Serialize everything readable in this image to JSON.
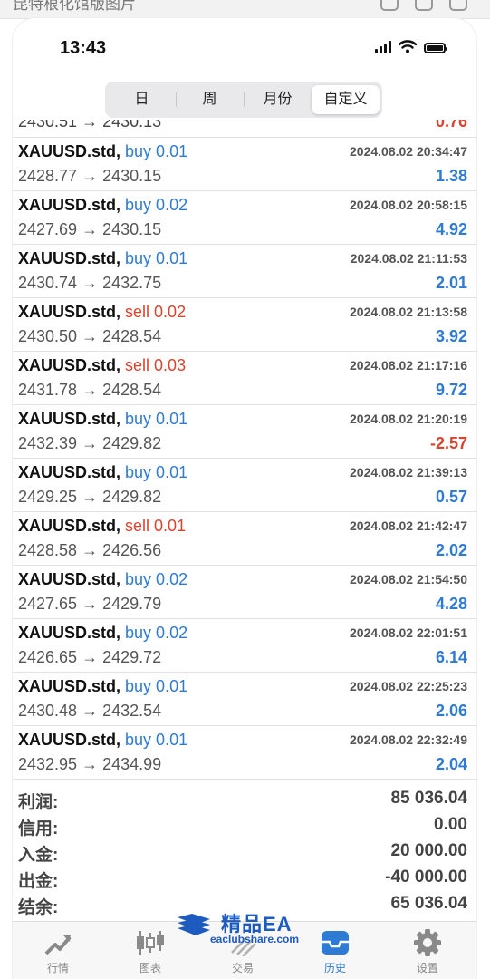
{
  "window": {
    "caption": "昆特根化馆版图片"
  },
  "status_bar": {
    "time": "13:43"
  },
  "period_tabs": [
    {
      "label": "日",
      "active": false
    },
    {
      "label": "周",
      "active": false
    },
    {
      "label": "月份",
      "active": false
    },
    {
      "label": "自定义",
      "active": true
    }
  ],
  "partial_row": {
    "prices": "2430.51 → 2430.13",
    "profit": "0.76"
  },
  "trades": [
    {
      "symbol": "XAUUSD.std,",
      "side": "buy 0.01",
      "type": "buy",
      "time": "2024.08.02 20:34:47",
      "prices": "2428.77 → 2430.15",
      "profit": "1.38"
    },
    {
      "symbol": "XAUUSD.std,",
      "side": "buy 0.02",
      "type": "buy",
      "time": "2024.08.02 20:58:15",
      "prices": "2427.69 → 2430.15",
      "profit": "4.92"
    },
    {
      "symbol": "XAUUSD.std,",
      "side": "buy 0.01",
      "type": "buy",
      "time": "2024.08.02 21:11:53",
      "prices": "2430.74 → 2432.75",
      "profit": "2.01"
    },
    {
      "symbol": "XAUUSD.std,",
      "side": "sell 0.02",
      "type": "sell",
      "time": "2024.08.02 21:13:58",
      "prices": "2430.50 → 2428.54",
      "profit": "3.92"
    },
    {
      "symbol": "XAUUSD.std,",
      "side": "sell 0.03",
      "type": "sell",
      "time": "2024.08.02 21:17:16",
      "prices": "2431.78 → 2428.54",
      "profit": "9.72"
    },
    {
      "symbol": "XAUUSD.std,",
      "side": "buy 0.01",
      "type": "buy",
      "time": "2024.08.02 21:20:19",
      "prices": "2432.39 → 2429.82",
      "profit": "-2.57"
    },
    {
      "symbol": "XAUUSD.std,",
      "side": "buy 0.01",
      "type": "buy",
      "time": "2024.08.02 21:39:13",
      "prices": "2429.25 → 2429.82",
      "profit": "0.57"
    },
    {
      "symbol": "XAUUSD.std,",
      "side": "sell 0.01",
      "type": "sell",
      "time": "2024.08.02 21:42:47",
      "prices": "2428.58 → 2426.56",
      "profit": "2.02"
    },
    {
      "symbol": "XAUUSD.std,",
      "side": "buy 0.02",
      "type": "buy",
      "time": "2024.08.02 21:54:50",
      "prices": "2427.65 → 2429.79",
      "profit": "4.28"
    },
    {
      "symbol": "XAUUSD.std,",
      "side": "buy 0.02",
      "type": "buy",
      "time": "2024.08.02 22:01:51",
      "prices": "2426.65 → 2429.72",
      "profit": "6.14"
    },
    {
      "symbol": "XAUUSD.std,",
      "side": "buy 0.01",
      "type": "buy",
      "time": "2024.08.02 22:25:23",
      "prices": "2430.48 → 2432.54",
      "profit": "2.06"
    },
    {
      "symbol": "XAUUSD.std,",
      "side": "buy 0.01",
      "type": "buy",
      "time": "2024.08.02 22:32:49",
      "prices": "2432.95 → 2434.99",
      "profit": "2.04"
    }
  ],
  "summary": [
    {
      "label": "利润:",
      "value": "85 036.04"
    },
    {
      "label": "信用:",
      "value": "0.00"
    },
    {
      "label": "入金:",
      "value": "20 000.00"
    },
    {
      "label": "出金:",
      "value": "-40 000.00"
    },
    {
      "label": "结余:",
      "value": "65 036.04"
    }
  ],
  "watermark": {
    "title": "精品EA",
    "subtitle": "eaclubshare.com"
  },
  "tab_bar": [
    {
      "label": "行情",
      "icon": "quotes-icon",
      "active": false
    },
    {
      "label": "图表",
      "icon": "chart-icon",
      "active": false
    },
    {
      "label": "交易",
      "icon": "trade-icon",
      "active": false
    },
    {
      "label": "历史",
      "icon": "history-icon",
      "active": true
    },
    {
      "label": "设置",
      "icon": "settings-icon",
      "active": false
    }
  ],
  "colors": {
    "buy": "#2e7bd6",
    "sell": "#d9442f",
    "active_tab": "#2e7bd6"
  }
}
